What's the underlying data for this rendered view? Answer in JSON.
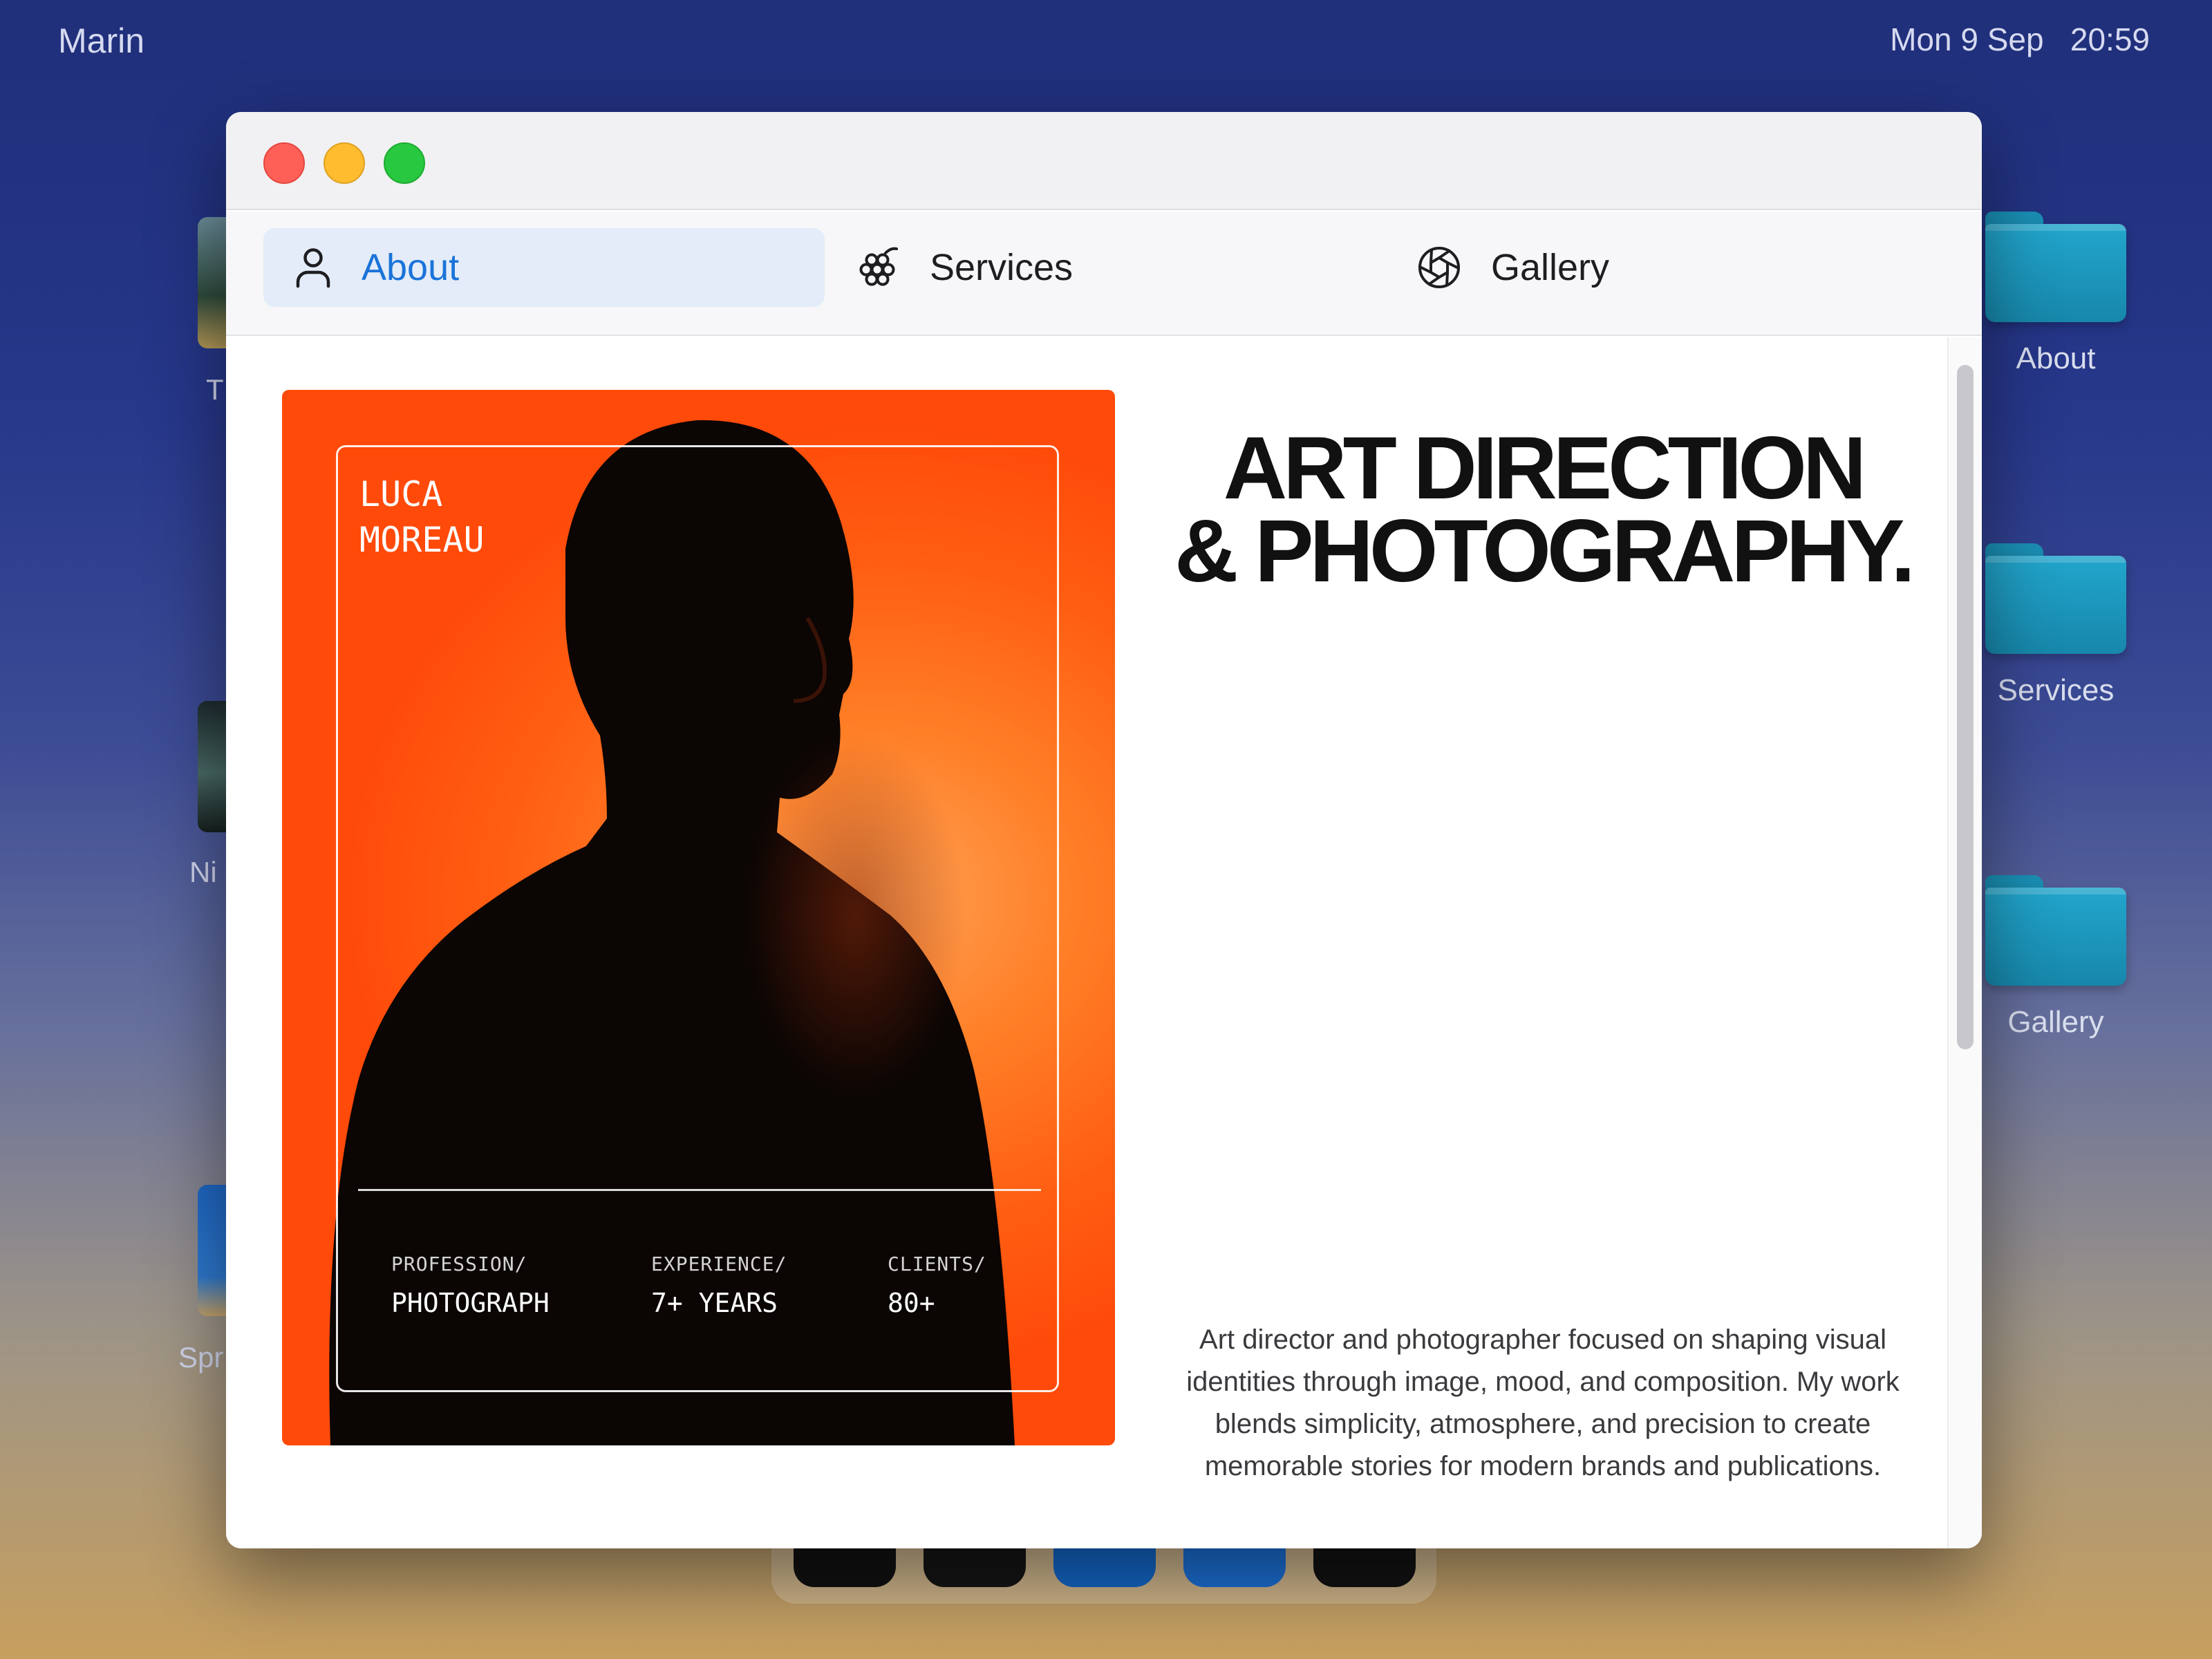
{
  "menubar": {
    "app_name": "Marin",
    "datetime": "Mon 9 Sep   20:59"
  },
  "desktop": {
    "left_items": [
      {
        "label_fragment": "T"
      },
      {
        "label_fragment": "Ni"
      },
      {
        "label_fragment": "Spr"
      }
    ],
    "folders": [
      {
        "label": "About",
        "icon": "folder-icon"
      },
      {
        "label": "Services",
        "icon": "folder-icon"
      },
      {
        "label": "Gallery",
        "icon": "folder-icon"
      }
    ]
  },
  "window": {
    "tabs": [
      {
        "label": "About",
        "icon": "person-icon",
        "active": true
      },
      {
        "label": "Services",
        "icon": "grapes-icon",
        "active": false
      },
      {
        "label": "Gallery",
        "icon": "aperture-icon",
        "active": false
      }
    ],
    "poster": {
      "name_line1": "LUCA",
      "name_line2": "MOREAU",
      "stats": [
        {
          "label": "PROFESSION/",
          "value": "PHOTOGRAPH"
        },
        {
          "label": "EXPERIENCE/",
          "value": "7+ YEARS"
        },
        {
          "label": "CLIENTS/",
          "value": "80+"
        }
      ]
    },
    "headline_line1": "ART DIRECTION",
    "headline_line2": "& PHOTOGRAPHY.",
    "bio": "Art director and photographer focused on shaping visual identities through image, mood, and composition. My work blends simplicity, atmosphere, and precision to create memorable stories for modern brands and publications."
  },
  "colors": {
    "accent": "#1a73d9",
    "poster_orange": "#ff5e12",
    "close": "#fe5f57",
    "minimize": "#febc2e",
    "maximize": "#28c840",
    "folder": "#22a6cd"
  }
}
